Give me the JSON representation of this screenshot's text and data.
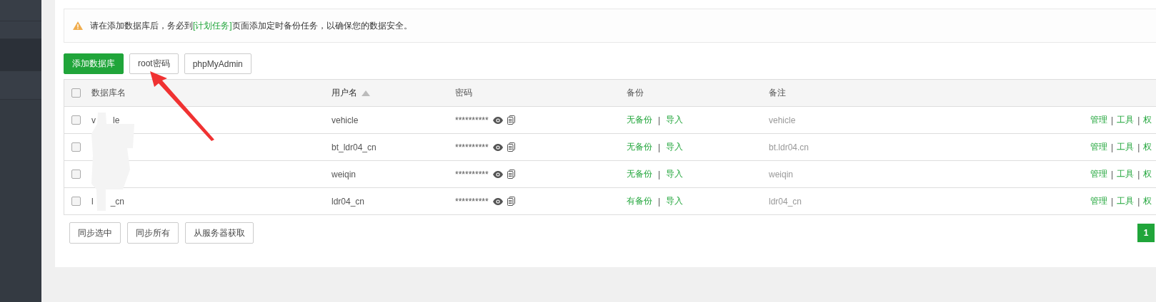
{
  "sidebar": {
    "items": [
      {
        "selected": false
      },
      {
        "selected": false
      },
      {
        "selected": true
      },
      {
        "selected": false
      }
    ]
  },
  "alert": {
    "text_before": "请在添加数据库后，务必到",
    "link": "[计划任务]",
    "text_after": "页面添加定时备份任务，以确保您的数据安全。"
  },
  "toolbar": {
    "buttons": [
      {
        "label": "添加数据库",
        "kind": "primary"
      },
      {
        "label": "root密码",
        "kind": "default"
      },
      {
        "label": "phpMyAdmin",
        "kind": "default"
      }
    ]
  },
  "table": {
    "header_checked": false,
    "columns": [
      {
        "label": "数据库名",
        "sorted": false
      },
      {
        "label": "用户名",
        "sorted": true
      },
      {
        "label": "密码",
        "sorted": false
      },
      {
        "label": "备份",
        "sorted": false
      },
      {
        "label": "备注",
        "sorted": false
      }
    ],
    "rows": [
      {
        "checked": false,
        "name_parts": [
          "v",
          "le"
        ],
        "user": "vehicle",
        "password": "**********",
        "backup": "无备份",
        "separator": "|",
        "import": "导入",
        "note": "vehicle",
        "actions": [
          "管理",
          "|",
          "工具",
          "|",
          "权"
        ]
      },
      {
        "checked": false,
        "name_parts": [],
        "user": "bt_ldr04_cn",
        "password": "**********",
        "backup": "无备份",
        "separator": "|",
        "import": "导入",
        "note": "bt.ldr04.cn",
        "actions": [
          "管理",
          "|",
          "工具",
          "|",
          "权"
        ]
      },
      {
        "checked": false,
        "name_parts": [],
        "user": "weiqin",
        "password": "**********",
        "backup": "无备份",
        "separator": "|",
        "import": "导入",
        "note": "weiqin",
        "actions": [
          "管理",
          "|",
          "工具",
          "|",
          "权"
        ]
      },
      {
        "checked": false,
        "name_parts": [
          "l",
          "_cn"
        ],
        "user": "ldr04_cn",
        "password": "**********",
        "backup": "有备份",
        "separator": "|",
        "import": "导入",
        "note": "ldr04_cn",
        "actions": [
          "管理",
          "|",
          "工具",
          "|",
          "权"
        ]
      }
    ]
  },
  "footer": {
    "buttons": [
      "同步选中",
      "同步所有",
      "从服务器获取"
    ],
    "pages": [
      {
        "label": "1",
        "selected": true
      }
    ]
  }
}
